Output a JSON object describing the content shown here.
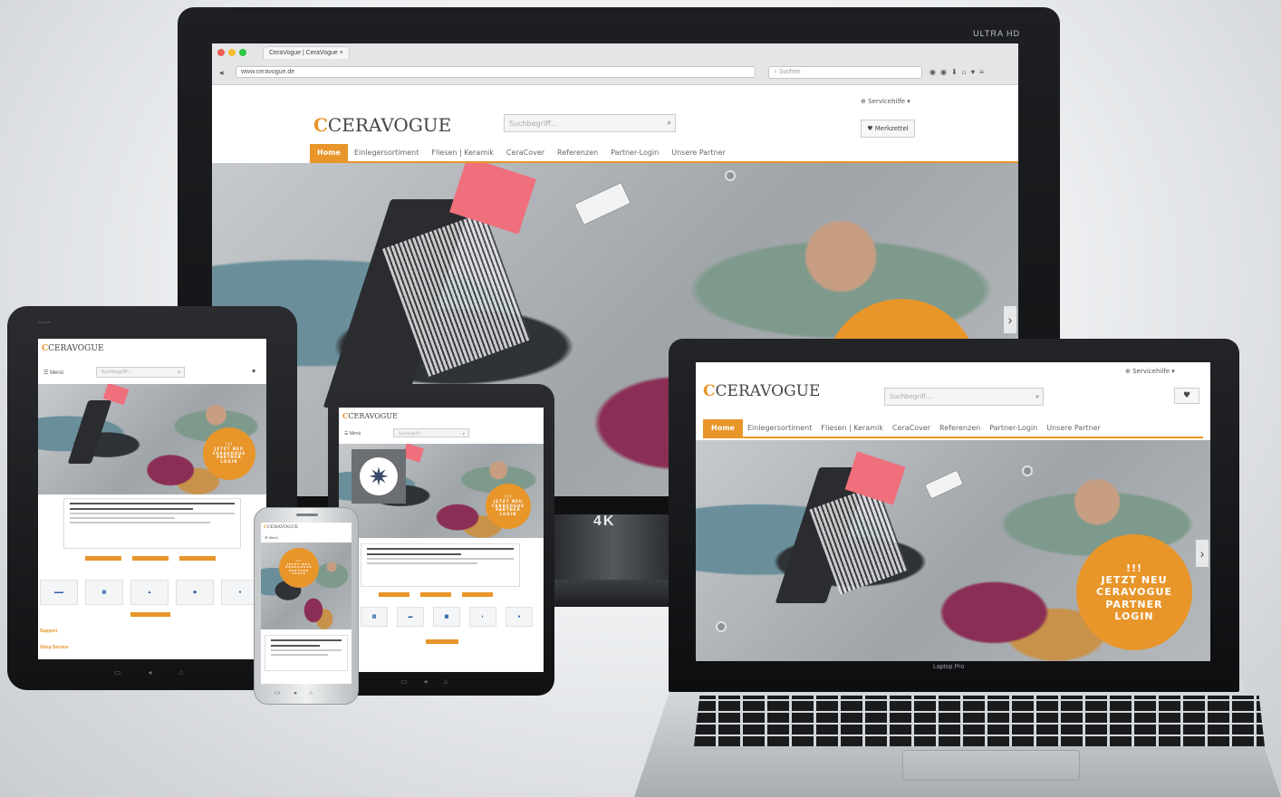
{
  "site": {
    "logo": "CERAVOGUE",
    "search_placeholder": "Suchbegriff...",
    "service_link": "Servicehilfe",
    "merkzettel": "Merkzettel",
    "menu_label": "Menü",
    "nav": [
      "Home",
      "Einlegersortiment",
      "Fliesen | Keramik",
      "CeraCover",
      "Referenzen",
      "Partner-Login",
      "Unsere Partner"
    ],
    "badge_line1": "!!!",
    "badge_text": "JETZT NEU CERAVOGUE PARTNER LOGIN",
    "badge_lines": [
      "JETZT NEU",
      "CERAVOGUE",
      "PARTNER",
      "LOGIN"
    ],
    "sidebar_links": [
      "Support",
      "Shop Service"
    ]
  },
  "browser": {
    "tab_title": "CeraVogue | CeraVogue",
    "url": "www.ceravogue.de",
    "search_placeholder": "Suchen"
  },
  "devices": {
    "monitor_brand": "ULTRA HD",
    "stand_logo": "4K",
    "laptop_brand": "Laptop Pro"
  },
  "colors": {
    "accent": "#e8952a",
    "device_dark": "#111214"
  },
  "icons": [
    "search-icon",
    "heart-icon",
    "menu-icon",
    "chevron-right-icon",
    "chevron-left-icon",
    "pin-icon"
  ]
}
